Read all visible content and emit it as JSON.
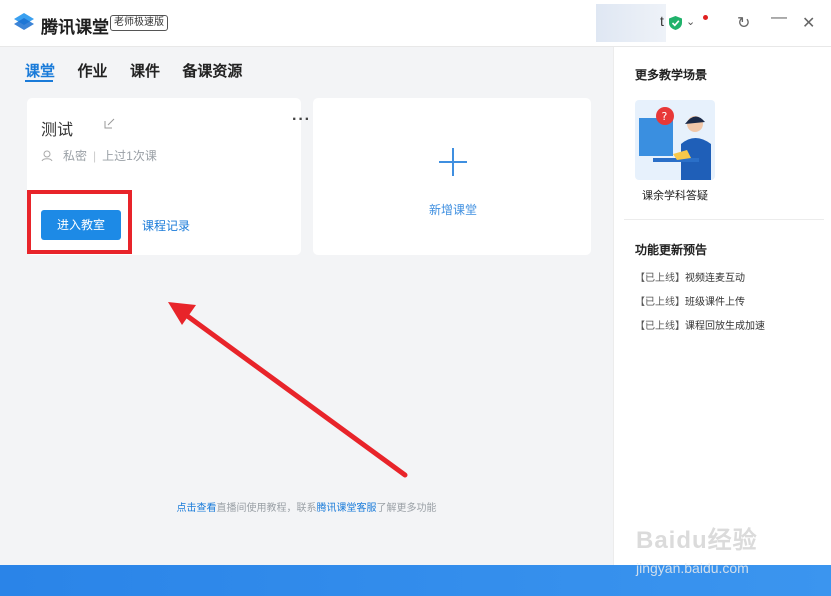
{
  "titlebar": {
    "app_name": "腾讯课堂",
    "edition_badge": "老师极速版",
    "username_fragment": "t"
  },
  "tabs": [
    {
      "label": "课堂",
      "active": true
    },
    {
      "label": "作业",
      "active": false
    },
    {
      "label": "课件",
      "active": false
    },
    {
      "label": "备课资源",
      "active": false
    }
  ],
  "course_card": {
    "title": "测试",
    "privacy": "私密",
    "last_class": "上过1次课",
    "enter_label": "进入教室",
    "record_label": "课程记录"
  },
  "add_card": {
    "label": "新增课堂"
  },
  "footer": {
    "part1": "点击查看",
    "part2": "直播间使用教程，联系",
    "part3": "腾讯课堂客服",
    "part4": "了解更多功能"
  },
  "sidebar": {
    "scenes_heading": "更多教学场景",
    "scene_label": "课余学科答疑",
    "updates_heading": "功能更新预告",
    "updates": [
      {
        "status": "【已上线】",
        "text": "视频连麦互动"
      },
      {
        "status": "【已上线】",
        "text": "班级课件上传"
      },
      {
        "status": "【已上线】",
        "text": "课程回放生成加速"
      }
    ]
  },
  "watermark": {
    "brand": "Baidu经验",
    "url": "jingyan.baidu.com"
  },
  "colors": {
    "accent": "#1a7bd9",
    "button_blue": "#1d8ae6",
    "highlight_red": "#e8242a",
    "bottom_bar": "#2a84e8"
  }
}
